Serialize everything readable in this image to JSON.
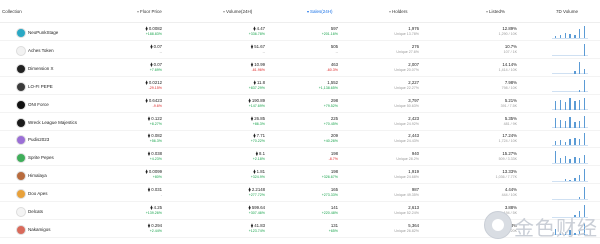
{
  "header": {
    "collection": "Collection",
    "floor": "Floor Price",
    "volume": "Volume(24H)",
    "sales": "Sales(24H)",
    "holders": "Holders",
    "listed": "Listed%",
    "volume7d": "7D Volume"
  },
  "rows": [
    {
      "name": "NeoPunkStage",
      "color": "#2aa8c4",
      "floor": "⧫ 0.0082",
      "floor_chg": "+188.83%",
      "floor_dir": "green",
      "vol": "⧫ 4.47",
      "vol_chg": "+336.78%",
      "vol_dir": "green",
      "sales": "597",
      "sales_chg": "+201.16%",
      "sales_dir": "green",
      "holders": "1,976",
      "holders_sub": "Unique 13.78%",
      "listed": "12.89%",
      "listed_sub": "1,290 / 10K",
      "bars": [
        2,
        3,
        5,
        4,
        3,
        9,
        12
      ]
    },
    {
      "name": "Aches Token",
      "color": "#f2f2f2",
      "floor": "⧫ 0.07",
      "floor_chg": "--",
      "floor_dir": "gray",
      "vol": "⧫ 51.67",
      "vol_chg": "--",
      "vol_dir": "gray",
      "sales": "505",
      "sales_chg": "--",
      "sales_dir": "gray",
      "holders": "276",
      "holders_sub": "Unique 27.6%",
      "listed": "10.7%",
      "listed_sub": "107 / 1K",
      "bars": [
        0,
        0,
        0,
        0,
        0,
        0,
        12
      ]
    },
    {
      "name": "Dimension X",
      "color": "#222222",
      "floor": "⧫ 0.07",
      "floor_chg": "+7.69%",
      "floor_dir": "green",
      "vol": "⧫ 10.99",
      "vol_chg": "-61.96%",
      "vol_dir": "red",
      "sales": "463",
      "sales_chg": "-60.3%",
      "sales_dir": "red",
      "holders": "2,007",
      "holders_sub": "Unique 20.07%",
      "listed": "14.14%",
      "listed_sub": "1,414 / 10K",
      "bars": [
        0,
        0,
        0,
        0,
        3,
        12,
        5
      ]
    },
    {
      "name": "LO-FI PEPE",
      "color": "#3b3b3b",
      "floor": "⧫ 0.0212",
      "floor_chg": "-29.15%",
      "floor_dir": "red",
      "vol": "⧫ 11.8",
      "vol_chg": "+837.29%",
      "vol_dir": "green",
      "sales": "1,552",
      "sales_chg": "+1,138.65%",
      "sales_dir": "green",
      "holders": "2,227",
      "holders_sub": "Unique 22.27%",
      "listed": "7.98%",
      "listed_sub": "798 / 10K",
      "bars": [
        0,
        0,
        0,
        0,
        0,
        2,
        12
      ]
    },
    {
      "name": "ONI Force",
      "color": "#111111",
      "floor": "⧫ 0.6423",
      "floor_chg": "-9.6%",
      "floor_dir": "red",
      "vol": "⧫ 190.89",
      "vol_chg": "+147.69%",
      "vol_dir": "green",
      "sales": "298",
      "sales_chg": "+79.52%",
      "sales_dir": "green",
      "holders": "3,797",
      "holders_sub": "Unique 50.63%",
      "listed": "5.21%",
      "listed_sub": "391 / 7.5K",
      "bars": [
        9,
        10,
        8,
        12,
        9,
        10,
        12
      ]
    },
    {
      "name": "Wreck League Majestics",
      "color": "#1b1b1b",
      "floor": "⧫ 0.122",
      "floor_chg": "+8.27%",
      "floor_dir": "green",
      "vol": "⧫ 26.85",
      "vol_chg": "+86.3%",
      "vol_dir": "green",
      "sales": "225",
      "sales_chg": "+70.45%",
      "sales_dir": "green",
      "holders": "2,423",
      "holders_sub": "Unique 24.92%",
      "listed": "5.35%",
      "listed_sub": "481 / 9K",
      "bars": [
        10,
        8,
        7,
        11,
        6,
        7,
        12
      ]
    },
    {
      "name": "Pudis2023",
      "color": "#9b6fd6",
      "floor": "⧫ 0.082",
      "floor_chg": "+56.3%",
      "floor_dir": "green",
      "vol": "⧫ 7.71",
      "vol_chg": "+70.22%",
      "vol_dir": "green",
      "sales": "209",
      "sales_chg": "+40.26%",
      "sales_dir": "green",
      "holders": "2,443",
      "holders_sub": "Unique 24.43%",
      "listed": "17.24%",
      "listed_sub": "1,724 / 10K",
      "bars": [
        4,
        5,
        3,
        6,
        7,
        6,
        12
      ]
    },
    {
      "name": "Sprite Pepes",
      "color": "#3fae5a",
      "floor": "⧫ 0.038",
      "floor_chg": "+4.23%",
      "floor_dir": "green",
      "vol": "⧫ 8.1",
      "vol_chg": "+2.18%",
      "vol_dir": "green",
      "sales": "198",
      "sales_chg": "-8.7%",
      "sales_dir": "red",
      "holders": "940",
      "holders_sub": "Unique 28.2%",
      "listed": "15.27%",
      "listed_sub": "509 / 3.33K",
      "bars": [
        12,
        5,
        7,
        4,
        6,
        5,
        8
      ]
    },
    {
      "name": "Himalaya",
      "color": "#b86b3d",
      "floor": "⧫ 0.0099",
      "floor_chg": "+80%",
      "floor_dir": "green",
      "vol": "⧫ 1.81",
      "vol_chg": "+324.9%",
      "vol_dir": "green",
      "sales": "198",
      "sales_chg": "+326.67%",
      "sales_dir": "green",
      "holders": "1,919",
      "holders_sub": "Unique 24.68%",
      "listed": "13.33%",
      "listed_sub": "1,036 / 7.77K",
      "bars": [
        0,
        0,
        2,
        1,
        3,
        6,
        12
      ]
    },
    {
      "name": "Doo Apes",
      "color": "#e8a13a",
      "floor": "⧫ 0.031",
      "floor_chg": "-",
      "floor_dir": "gray",
      "vol": "⧫ 2.2148",
      "vol_chg": "+277.72%",
      "vol_dir": "green",
      "sales": "165",
      "sales_chg": "+273.33%",
      "sales_dir": "green",
      "holders": "987",
      "holders_sub": "Unique 49.35%",
      "listed": "4.44%",
      "listed_sub": "444 / 10K",
      "bars": [
        0,
        0,
        0,
        0,
        0,
        2,
        12
      ]
    },
    {
      "name": "Delcats",
      "color": "#f4f4f4",
      "floor": "⧫ 4.25",
      "floor_chg": "+139.26%",
      "floor_dir": "green",
      "vol": "⧫ 599.64",
      "vol_chg": "+307.46%",
      "vol_dir": "green",
      "sales": "141",
      "sales_chg": "+220.48%",
      "sales_dir": "green",
      "holders": "2,613",
      "holders_sub": "Unique 52.24%",
      "listed": "3.88%",
      "listed_sub": "194 / 5K",
      "bars": [
        0,
        0,
        0,
        0,
        2,
        6,
        12
      ]
    },
    {
      "name": "Nakamigos",
      "color": "#d96a5b",
      "floor": "⧫ 0.294",
      "floor_chg": "+2.44%",
      "floor_dir": "green",
      "vol": "⧫ 41.83",
      "vol_chg": "+123.74%",
      "vol_dir": "green",
      "sales": "131",
      "sales_chg": "+65%",
      "sales_dir": "green",
      "holders": "5,364",
      "holders_sub": "Unique 26.82%",
      "listed": "1.3%",
      "listed_sub": "280 / 20K",
      "bars": [
        6,
        4,
        3,
        5,
        2,
        4,
        12
      ]
    }
  ],
  "watermark": {
    "text": "金色财经"
  }
}
